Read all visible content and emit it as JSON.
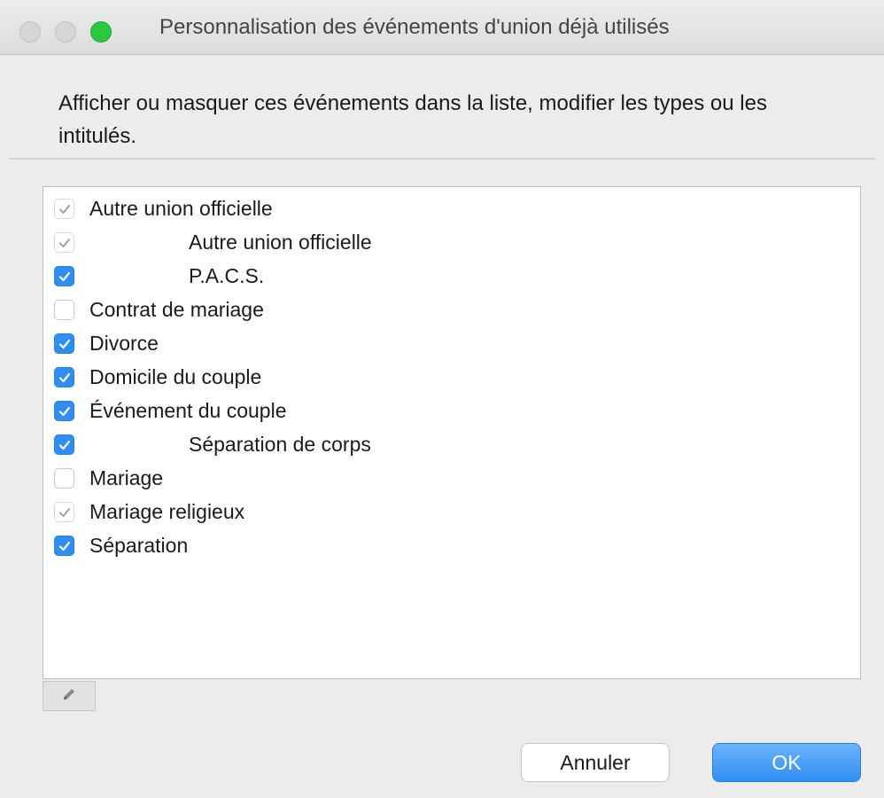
{
  "window": {
    "title": "Personnalisation des événements d'union déjà utilisés"
  },
  "instruction": "Afficher ou masquer ces événements dans la liste, modifier les types ou les intitulés.",
  "items": [
    {
      "label": "Autre union officielle",
      "level": 0,
      "state": "checked-disabled"
    },
    {
      "label": "Autre union officielle",
      "level": 1,
      "state": "checked-disabled"
    },
    {
      "label": "P.A.C.S.",
      "level": 1,
      "state": "checked"
    },
    {
      "label": "Contrat de mariage",
      "level": 0,
      "state": "unchecked"
    },
    {
      "label": "Divorce",
      "level": 0,
      "state": "checked"
    },
    {
      "label": "Domicile du couple",
      "level": 0,
      "state": "checked"
    },
    {
      "label": "Événement du couple",
      "level": 0,
      "state": "checked"
    },
    {
      "label": "Séparation de corps",
      "level": 1,
      "state": "checked"
    },
    {
      "label": "Mariage",
      "level": 0,
      "state": "unchecked"
    },
    {
      "label": "Mariage religieux",
      "level": 0,
      "state": "checked-disabled"
    },
    {
      "label": "Séparation",
      "level": 0,
      "state": "checked"
    }
  ],
  "edit_icon": "pencil-icon",
  "buttons": {
    "cancel": "Annuler",
    "ok": "OK"
  },
  "colors": {
    "accent": "#2f8ef4",
    "zoom_light": "#29c840"
  }
}
